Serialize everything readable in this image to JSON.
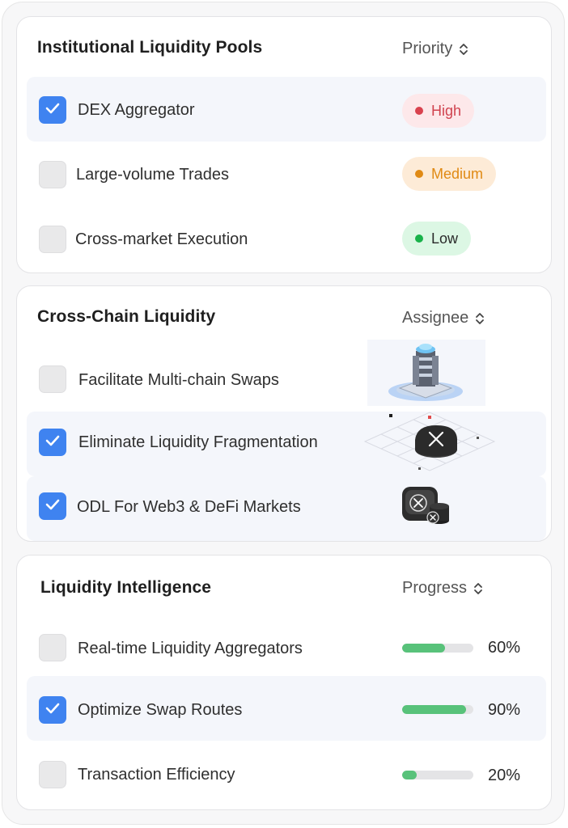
{
  "colors": {
    "checkbox_checked": "#3f83f0",
    "checkbox_unchecked": "#e9e9ea",
    "high": "#d9424e",
    "medium": "#e08a14",
    "low": "#19b24a",
    "progress": "#58c27a"
  },
  "sections": {
    "pools": {
      "title": "Institutional Liquidity Pools",
      "column": "Priority",
      "rows": [
        {
          "label": "DEX Aggregator",
          "checked": true,
          "priority": "High"
        },
        {
          "label": "Large-volume Trades",
          "checked": false,
          "priority": "Medium"
        },
        {
          "label": "Cross-market Execution",
          "checked": false,
          "priority": "Low"
        }
      ]
    },
    "crosschain": {
      "title": "Cross-Chain Liquidity",
      "column": "Assignee",
      "rows": [
        {
          "label": "Facilitate Multi-chain Swaps",
          "checked": false,
          "assignee_icon": "tower-icon"
        },
        {
          "label": "Eliminate Liquidity Fragmentation",
          "checked": true,
          "assignee_icon": "xrp-token-icon"
        },
        {
          "label": "ODL For Web3 & DeFi Markets",
          "checked": true,
          "assignee_icon": "xrp-coin-stack-icon"
        }
      ]
    },
    "intel": {
      "title": "Liquidity Intelligence",
      "column": "Progress",
      "rows": [
        {
          "label": "Real-time Liquidity Aggregators",
          "checked": false,
          "progress": 0.6,
          "progress_text": "60%"
        },
        {
          "label": "Optimize Swap Routes",
          "checked": true,
          "progress": 0.9,
          "progress_text": "90%"
        },
        {
          "label": "Transaction Efficiency",
          "checked": false,
          "progress": 0.2,
          "progress_text": "20%"
        }
      ]
    }
  }
}
